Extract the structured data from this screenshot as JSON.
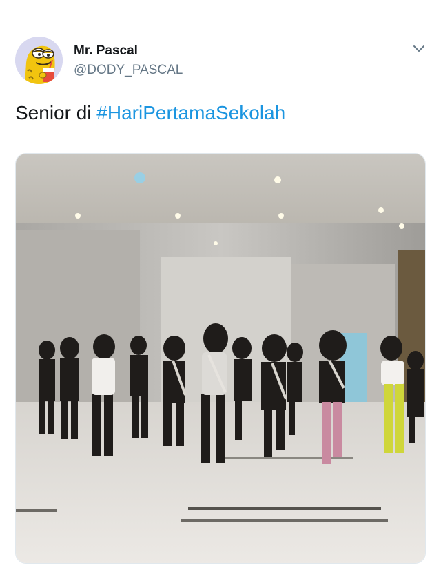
{
  "tweet": {
    "display_name": "Mr. Pascal",
    "handle": "@DODY_PASCAL",
    "text_prefix": "Senior di ",
    "hashtag": "#HariPertamaSekolah",
    "menu_icon": "chevron-down-icon",
    "avatar_icon": "cartoon-fish-avatar"
  },
  "media": {
    "description_icon": "dance-video-thumbnail"
  },
  "colors": {
    "hashtag": "#1b95e0",
    "name": "#14171a",
    "handle": "#657786",
    "divider": "#cfd9de"
  }
}
